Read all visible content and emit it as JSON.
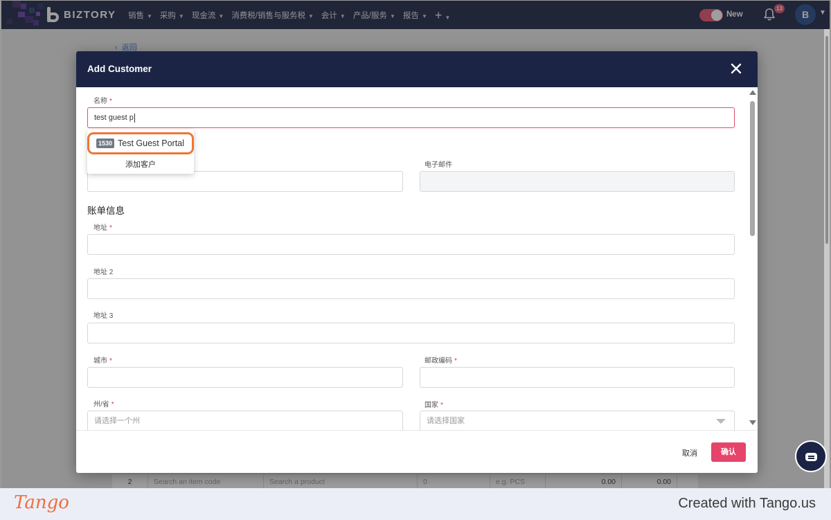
{
  "navbar": {
    "brand": "BIZTORY",
    "menu": [
      {
        "label": "销售"
      },
      {
        "label": "采购"
      },
      {
        "label": "现金流"
      },
      {
        "label": "消费税/销售与服务税"
      },
      {
        "label": "会计"
      },
      {
        "label": "产品/服务"
      },
      {
        "label": "报告"
      }
    ],
    "plus_symbol": "+",
    "new_toggle_label": "New",
    "notification_count": "13",
    "avatar_initial": "B",
    "accent_color": "#e8506d",
    "bar_color": "#1b2444"
  },
  "page": {
    "back_label": "返回",
    "behind_row": {
      "index": "2",
      "item_code_placeholder": "Search an item code",
      "product_placeholder": "Search a product",
      "quantity": "0",
      "unit_placeholder": "e.g. PCS",
      "price": "0.00",
      "total": "0.00"
    }
  },
  "modal": {
    "title": "Add Customer",
    "name_label": "名称",
    "name_value": "test guest p",
    "autocomplete": {
      "options": [
        {
          "code": "1530",
          "name": "Test Guest Portal"
        }
      ],
      "add_label": "添加客户"
    },
    "email_label": "电子邮件",
    "billing_title": "账单信息",
    "address_label": "地址",
    "address2_label": "地址 2",
    "address3_label": "地址 3",
    "city_label": "城市",
    "postcode_label": "邮政编码",
    "state_label": "州/省",
    "state_placeholder": "请选择一个州",
    "country_label": "国家",
    "country_placeholder": "请选择国家",
    "cancel_label": "取消",
    "confirm_label": "确认"
  },
  "footer": {
    "tango_logo": "Tango",
    "credit": "Created with Tango.us"
  }
}
